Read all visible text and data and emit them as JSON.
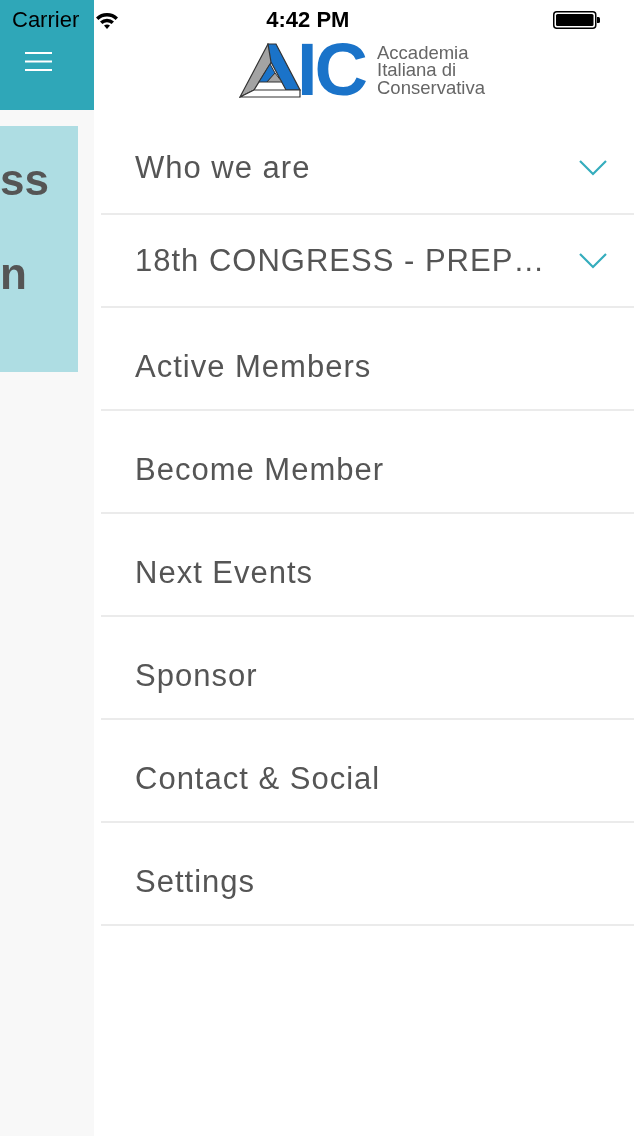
{
  "status_bar": {
    "carrier": "Carrier",
    "time": "4:42 PM"
  },
  "side_panel": {
    "card": {
      "lines": [
        "ss",
        "n"
      ]
    }
  },
  "logo": {
    "letters": "IC",
    "name_lines": [
      "Accademia",
      "Italiana di",
      "Conservativa"
    ]
  },
  "menu": [
    {
      "label": "Who we are",
      "kind": "group"
    },
    {
      "label": "18th CONGRESS - PREP…",
      "kind": "group"
    },
    {
      "label": "Active Members",
      "kind": "link"
    },
    {
      "label": "Become Member",
      "kind": "link"
    },
    {
      "label": "Next Events",
      "kind": "link"
    },
    {
      "label": "Sponsor",
      "kind": "link"
    },
    {
      "label": "Contact & Social",
      "kind": "link"
    },
    {
      "label": "Settings",
      "kind": "link"
    }
  ]
}
